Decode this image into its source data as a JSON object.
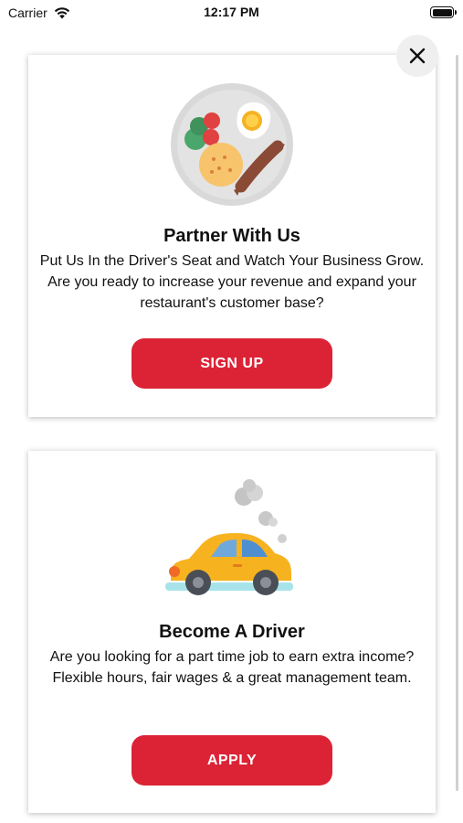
{
  "status_bar": {
    "carrier": "Carrier",
    "time": "12:17 PM"
  },
  "cards": [
    {
      "illustration": "food-plate-icon",
      "title": "Partner With Us",
      "text": "Put Us In the Driver's Seat and Watch Your Business Grow. Are you ready to increase your revenue and expand your restaurant's customer base?",
      "button_label": "SIGN UP"
    },
    {
      "illustration": "car-icon",
      "title": "Become A Driver",
      "text": "Are you looking for a part time job to earn extra income? Flexible hours, fair wages & a great management team.",
      "button_label": "APPLY"
    }
  ],
  "colors": {
    "accent": "#dc2336",
    "close_bg": "#efefef"
  }
}
